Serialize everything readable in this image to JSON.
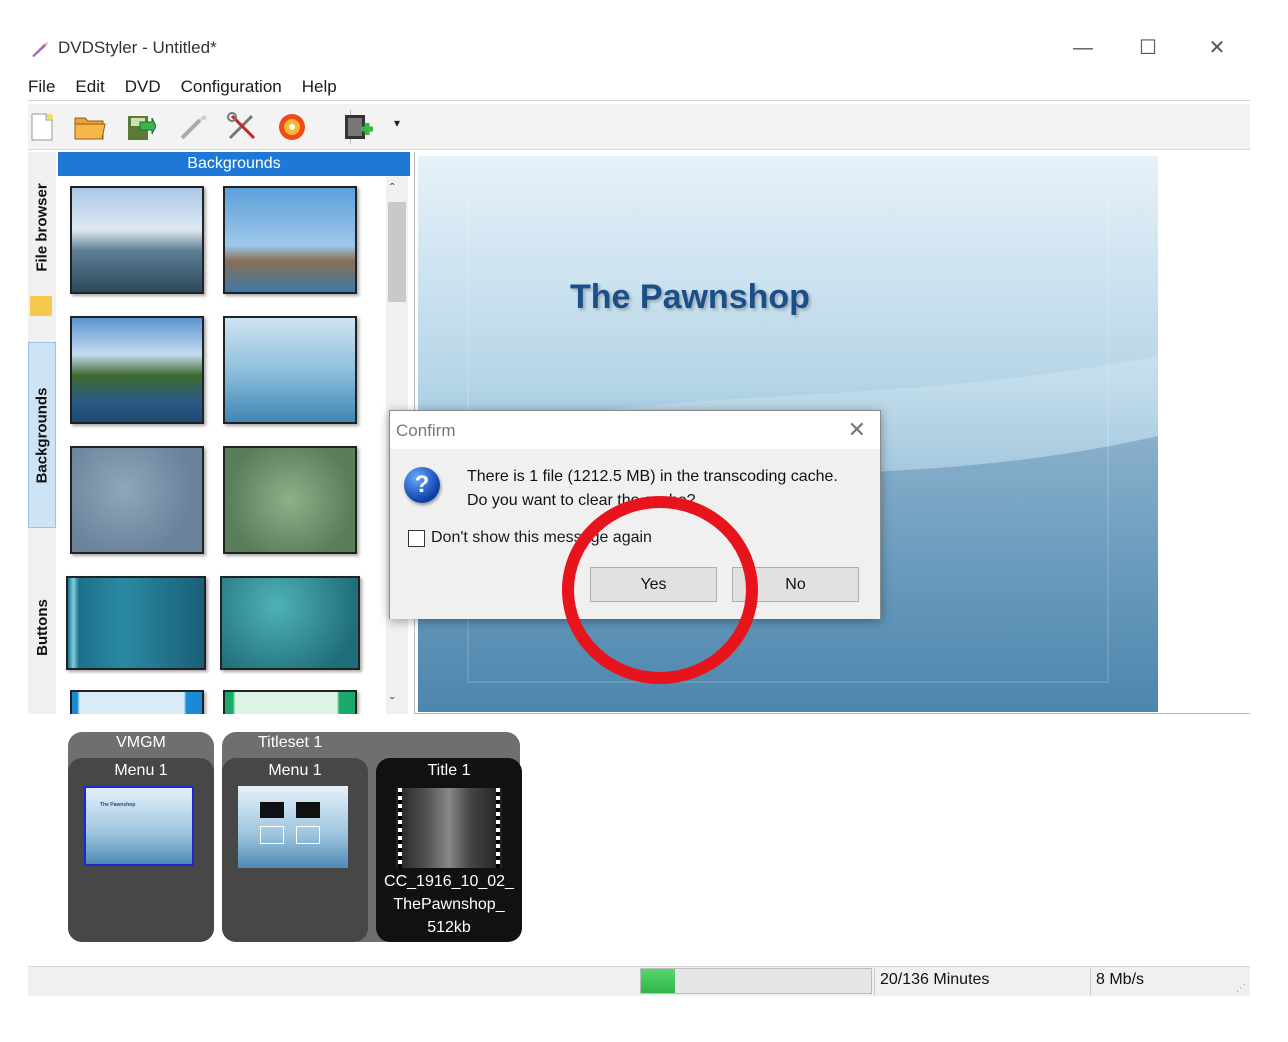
{
  "window": {
    "title": "DVDStyler - Untitled*",
    "minimize": "—",
    "maximize": "☐",
    "close": "✕"
  },
  "menu": [
    "File",
    "Edit",
    "DVD",
    "Configuration",
    "Help"
  ],
  "toolbar": {
    "icons": [
      "new-file-icon",
      "open-folder-icon",
      "save-icon",
      "wand-icon",
      "settings-tools-icon",
      "burn-disc-icon",
      "add-video-icon"
    ],
    "dropdown": "▾"
  },
  "side_tabs": [
    "File browser",
    "Backgrounds",
    "Buttons"
  ],
  "backgrounds_panel": {
    "header": "Backgrounds",
    "scroll_up": "ˆ",
    "scroll_down": "ˇ"
  },
  "preview": {
    "menu_title": "The Pawnshop"
  },
  "dialog": {
    "title": "Confirm",
    "close": "✕",
    "icon": "?",
    "message_line1": "There is 1 file (1212.5 MB) in the transcoding cache.",
    "message_line2": "Do you want to clear the cache?",
    "checkbox_label": "Don't show this message again",
    "yes": "Yes",
    "no": "No"
  },
  "titleset_area": {
    "vmgm": {
      "group": "VMGM",
      "card": "Menu 1",
      "thumb_text": "The Pawnshop"
    },
    "titleset": {
      "group": "Titleset 1",
      "menu": "Menu 1",
      "title": "Title 1",
      "title_caption": [
        "CC_1916_10_02_",
        "ThePawnshop_",
        "512kb"
      ]
    }
  },
  "status": {
    "progress_percent": 14.7,
    "minutes": "20/136 Minutes",
    "bitrate": "8 Mb/s"
  },
  "colors": {
    "accent_blue": "#1e79d6",
    "annotation_red": "#e8141c",
    "progress_green": "#2fb54a"
  }
}
